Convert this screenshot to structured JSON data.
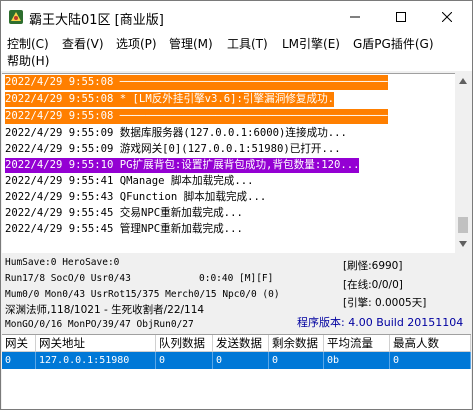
{
  "window": {
    "title": "霸王大陆01区 [商业版]",
    "minimize": "minimize",
    "maximize": "maximize",
    "close": "close"
  },
  "menu": [
    {
      "label": "控制(C)"
    },
    {
      "label": "查看(V)"
    },
    {
      "label": "选项(P)"
    },
    {
      "label": "管理(M)"
    },
    {
      "label": "工具(T)"
    },
    {
      "label": "LM引擎(E)"
    },
    {
      "label": "G盾PG插件(G)"
    },
    {
      "label": "帮助(H)"
    }
  ],
  "log": [
    {
      "text": "2022/4/29 9:55:08 ──────────────────────────────────────────",
      "style": "orange"
    },
    {
      "text": "2022/4/29 9:55:08 * [LM反外挂引擎v3.6]:引擎漏洞修复成功.      ",
      "style": "orange"
    },
    {
      "text": "2022/4/29 9:55:08 ──────────────────────────────────────────",
      "style": "orange"
    },
    {
      "text": "2022/4/29 9:55:09 数据库服务器(127.0.0.1:6000)连接成功...",
      "style": "normal"
    },
    {
      "text": "2022/4/29 9:55:09 游戏网关[0](127.0.0.1:51980)已打开...",
      "style": "normal"
    },
    {
      "text": "2022/4/29 9:55:10 PG扩展背包:设置扩展背包成功,背包数量:120...",
      "style": "purple"
    },
    {
      "text": "2022/4/29 9:55:41 QManage 脚本加载完成...",
      "style": "normal"
    },
    {
      "text": "2022/4/29 9:55:43 QFunction 脚本加载完成...",
      "style": "normal"
    },
    {
      "text": "2022/4/29 9:55:45 交易NPC重新加载完成...",
      "style": "normal"
    },
    {
      "text": "2022/4/29 9:55:45 管理NPC重新加载完成...",
      "style": "normal"
    }
  ],
  "status": {
    "line1": "HumSave:0 HeroSave:0",
    "line2": "Run17/8 SocO/0 Usr0/43",
    "line2_time": "0:0:40 [M][F]",
    "line3": "Mum0/0 Mon0/43 UsrRot15/375 Merch0/15 Npc0/0 (0)",
    "line4": "深渊法师,118/1021 - 生死收割者/22/114",
    "line5": "MonGO/0/16 MonPO/39/47 ObjRun0/27",
    "refresh": "[刷怪:6990]",
    "online": "[在线:0/0/0]",
    "engine": "[引擎: 0.0005天]",
    "version": "程序版本: 4.00 Build 20151104"
  },
  "table": {
    "headers": [
      "网关",
      "网关地址",
      "队列数据",
      "发送数据",
      "剩余数据",
      "平均流量",
      "最高人数"
    ],
    "rows": [
      [
        "0",
        "127.0.0.1:51980",
        "0",
        "0",
        "0",
        "0b",
        "0"
      ]
    ]
  },
  "colors": {
    "orange_highlight": "#ff7f00",
    "purple_highlight": "#9400d3",
    "selection": "#0078d7",
    "version_text": "#0000a0"
  }
}
